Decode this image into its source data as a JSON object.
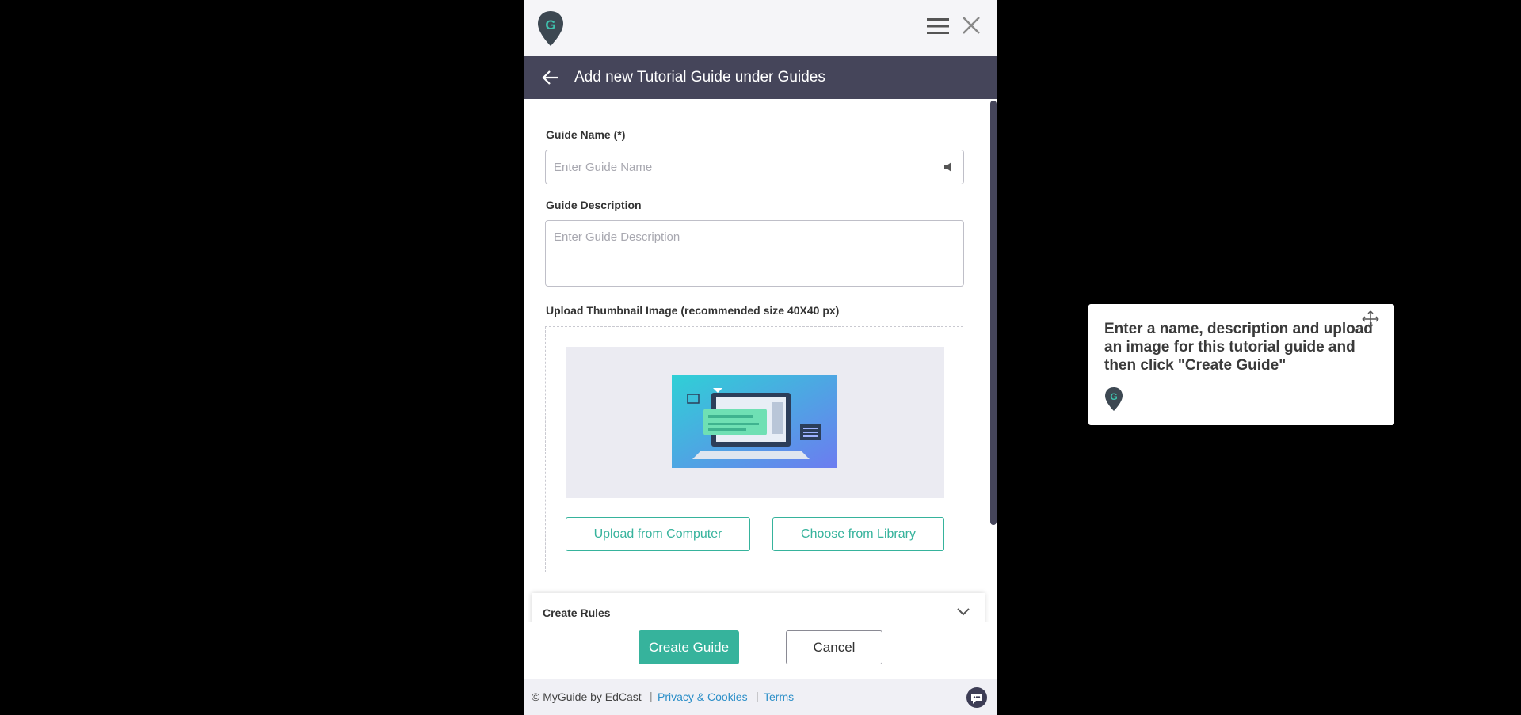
{
  "app": {
    "brand_color": "#36b39c",
    "header_color": "#45455a"
  },
  "header": {
    "title": "Add new Tutorial Guide under Guides"
  },
  "form": {
    "name_label": "Guide Name (*)",
    "name_placeholder": "Enter Guide Name",
    "name_value": "",
    "desc_label": "Guide Description",
    "desc_placeholder": "Enter Guide Description",
    "desc_value": "",
    "thumb_label": "Upload Thumbnail Image (recommended size 40X40 px)",
    "upload_computer": "Upload from Computer",
    "choose_library": "Choose from Library"
  },
  "rules": {
    "label": "Create Rules"
  },
  "actions": {
    "create": "Create Guide",
    "cancel": "Cancel"
  },
  "footer": {
    "copyright": "© MyGuide by EdCast",
    "privacy": "Privacy & Cookies",
    "terms": "Terms",
    "separator": "|"
  },
  "tooltip": {
    "text": "Enter a name, description and upload an image for this tutorial guide and then click \"Create Guide\""
  },
  "icons": [
    "myguide-logo-icon",
    "hamburger-menu-icon",
    "close-icon",
    "back-arrow-icon",
    "speaker-icon",
    "chevron-down-icon",
    "chat-icon",
    "move-icon"
  ]
}
